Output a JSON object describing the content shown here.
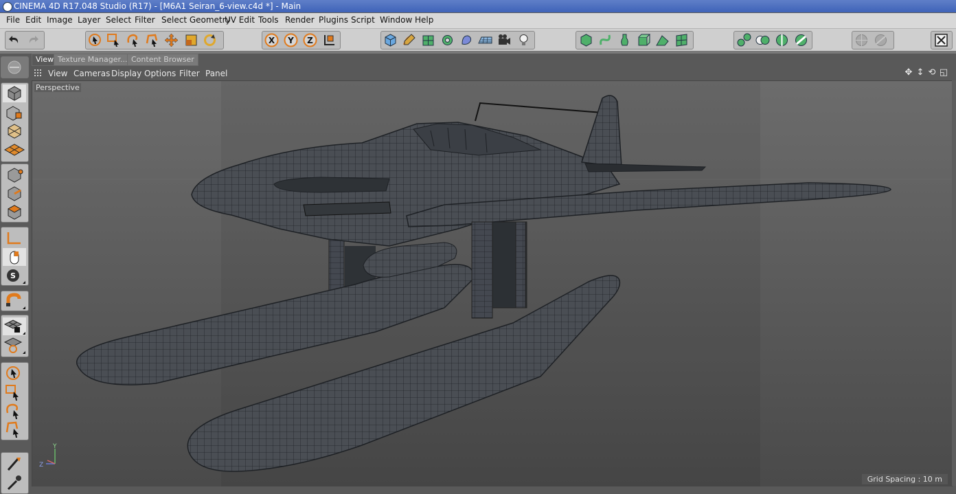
{
  "window": {
    "title": "CINEMA 4D R17.048 Studio (R17) - [M6A1 Seiran_6-view.c4d *] - Main"
  },
  "menu": [
    "File",
    "Edit",
    "Image",
    "Layer",
    "Select",
    "Filter",
    "Select Geometry",
    "UV Edit",
    "Tools",
    "Render",
    "Plugins",
    "Script",
    "Window",
    "Help"
  ],
  "tabs": {
    "view": "View",
    "texture": "Texture Manager...",
    "content": "Content Browser"
  },
  "viewmenu": [
    "View",
    "Cameras",
    "Display",
    "Options",
    "Filter",
    "Panel"
  ],
  "viewport": {
    "name": "Perspective",
    "grid_spacing": "Grid Spacing : 10 m",
    "axis_y": "Y",
    "axis_z": "Z"
  },
  "toolbar_axes": [
    "X",
    "Y",
    "Z"
  ],
  "colors": {
    "accent": "#e07a1c",
    "bg": "#595959"
  }
}
